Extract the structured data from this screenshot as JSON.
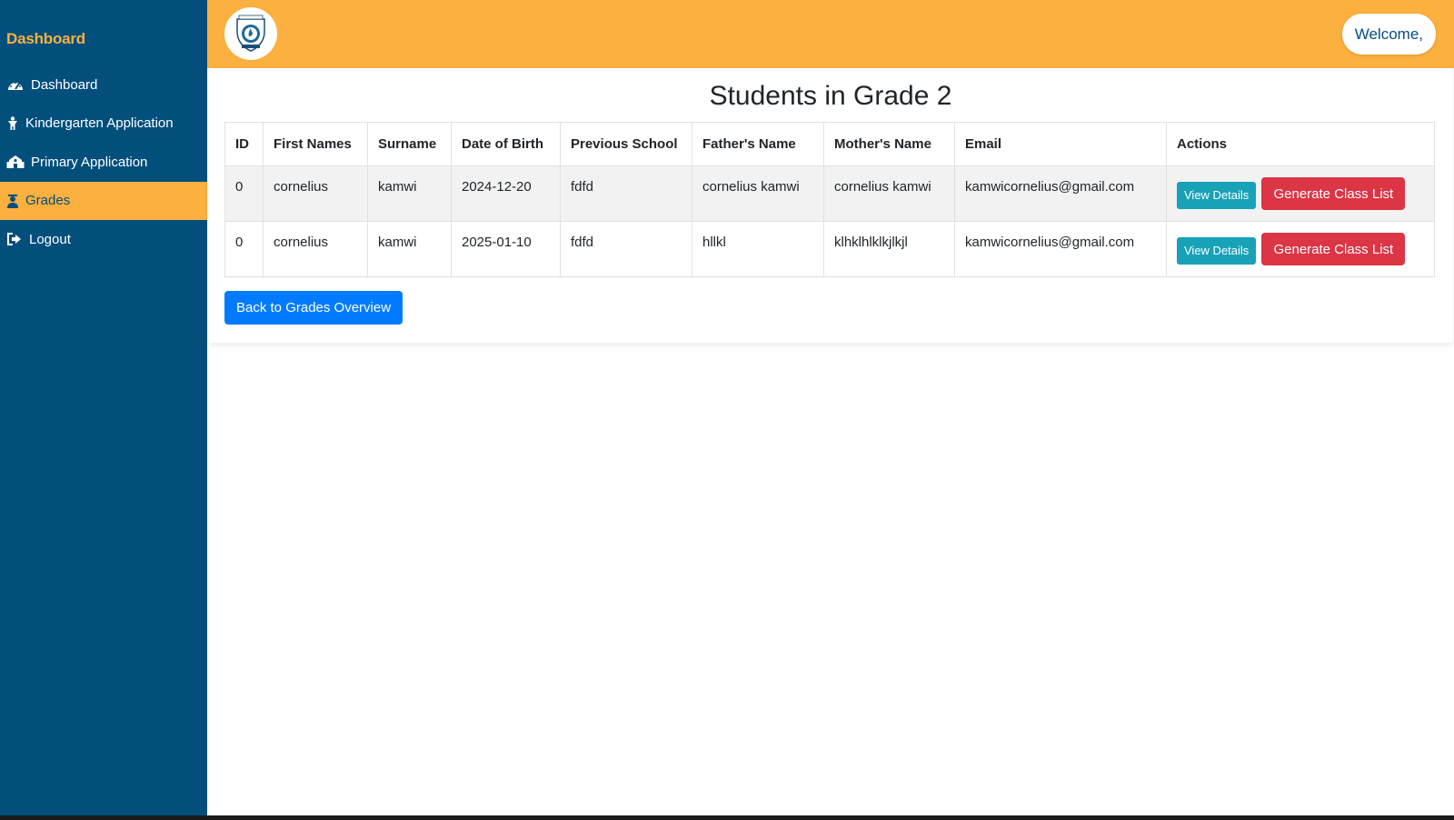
{
  "sidebar": {
    "brand": "Dashboard",
    "items": [
      {
        "label": "Dashboard",
        "icon": "tachometer-icon",
        "active": false
      },
      {
        "label": "Kindergarten Application",
        "icon": "child-icon",
        "active": false
      },
      {
        "label": "Primary Application",
        "icon": "school-icon",
        "active": false
      },
      {
        "label": "Grades",
        "icon": "student-icon",
        "active": true
      },
      {
        "label": "Logout",
        "icon": "sign-out-icon",
        "active": false
      }
    ]
  },
  "header": {
    "logo": "school-crest-icon",
    "welcome": "Welcome,"
  },
  "main": {
    "title": "Students in Grade 2",
    "columns": [
      "ID",
      "First Names",
      "Surname",
      "Date of Birth",
      "Previous School",
      "Father's Name",
      "Mother's Name",
      "Email",
      "Actions"
    ],
    "rows": [
      {
        "id": "0",
        "first_names": "cornelius",
        "surname": "kamwi",
        "dob": "2024-12-20",
        "previous_school": "fdfd",
        "father": "cornelius kamwi",
        "mother": "cornelius kamwi",
        "email": "kamwicornelius@gmail.com"
      },
      {
        "id": "0",
        "first_names": "cornelius",
        "surname": "kamwi",
        "dob": "2025-01-10",
        "previous_school": "fdfd",
        "father": "hllkl",
        "mother": "klhklhlklkjlkjl",
        "email": "kamwicornelius@gmail.com"
      }
    ],
    "actions": {
      "view": "View Details",
      "generate": "Generate Class List"
    },
    "back_button": "Back to Grades Overview"
  },
  "colors": {
    "sidebar_bg": "#024f7c",
    "accent": "#fbb040",
    "view_button": "#17a2b8",
    "generate_button": "#dc3545",
    "back_button": "#007bff"
  }
}
